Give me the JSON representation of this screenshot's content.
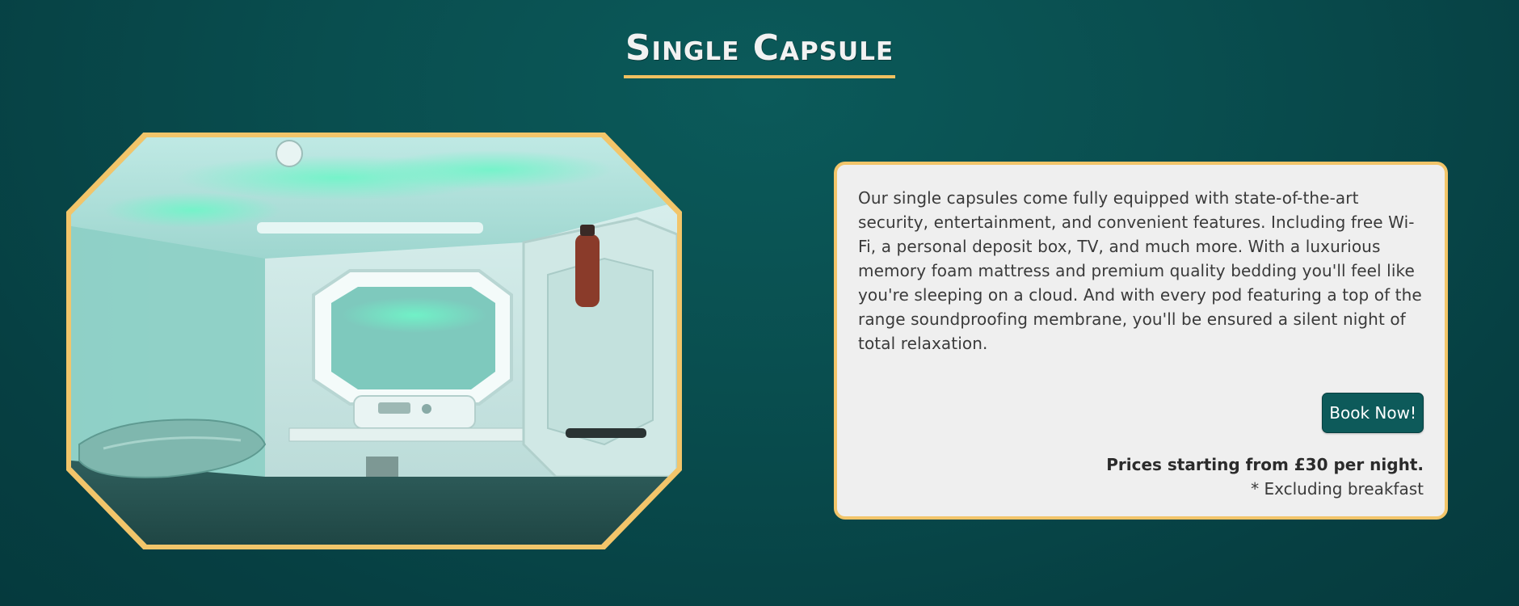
{
  "page": {
    "title": "Single Capsule"
  },
  "image": {
    "alt": "Interior of a futuristic sleeping capsule with teal lighting"
  },
  "info": {
    "description": "Our single capsules come fully equipped with state-of-the-art security, entertainment, and convenient features. Including free Wi-Fi, a personal deposit box, TV, and much more. With a luxurious memory foam mattress and premium quality bedding you'll feel like you're sleeping on a cloud. And with every pod featuring a top of the range soundproofing membrane, you'll be ensured a silent night of total relaxation.",
    "book_button_label": "Book Now!",
    "price_text": "Prices starting from £30 per night.",
    "price_note": "* Excluding breakfast"
  },
  "colors": {
    "background": "#094e4f",
    "accent_gold": "#f2c56a",
    "card_background": "#efefef",
    "button_background": "#0d5a5a"
  }
}
